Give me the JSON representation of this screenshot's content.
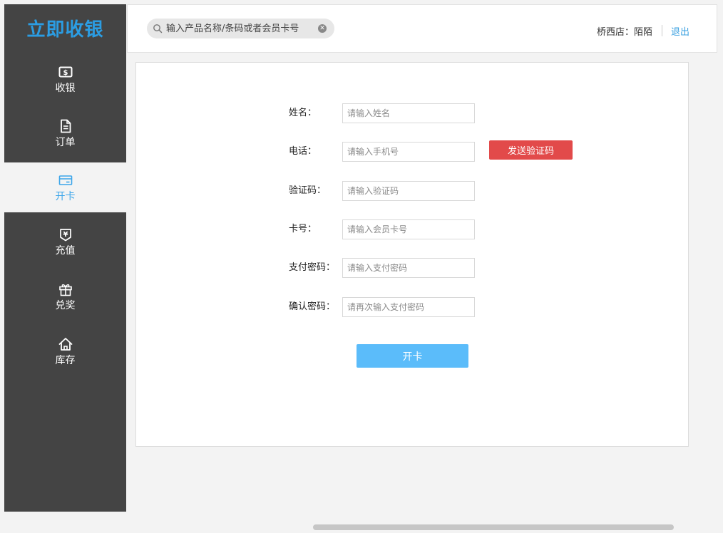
{
  "app": {
    "logo": "立即收银"
  },
  "sidebar": {
    "items": [
      {
        "label": "收银",
        "icon": "cash-icon"
      },
      {
        "label": "订单",
        "icon": "document-icon"
      },
      {
        "label": "开卡",
        "icon": "card-icon",
        "active": true
      },
      {
        "label": "充值",
        "icon": "recharge-icon"
      },
      {
        "label": "兑奖",
        "icon": "gift-icon"
      },
      {
        "label": "库存",
        "icon": "home-icon"
      }
    ]
  },
  "header": {
    "search_placeholder": "输入产品名称/条码或者会员卡号",
    "store": "桥西店：陌陌",
    "logout": "退出"
  },
  "form": {
    "fields": [
      {
        "label": "姓名：",
        "placeholder": "请输入姓名"
      },
      {
        "label": "电话：",
        "placeholder": "请输入手机号"
      },
      {
        "label": "验证码：",
        "placeholder": "请输入验证码"
      },
      {
        "label": "卡号：",
        "placeholder": "请输入会员卡号"
      },
      {
        "label": "支付密码：",
        "placeholder": "请输入支付密码"
      },
      {
        "label": "确认密码：",
        "placeholder": "请再次输入支付密码"
      }
    ],
    "send_code": "发送验证码",
    "submit": "开卡"
  },
  "colors": {
    "accent": "#3da6ea",
    "sidebar_bg": "#444444",
    "danger": "#e24a4a",
    "primary_button": "#5bbcfa"
  }
}
